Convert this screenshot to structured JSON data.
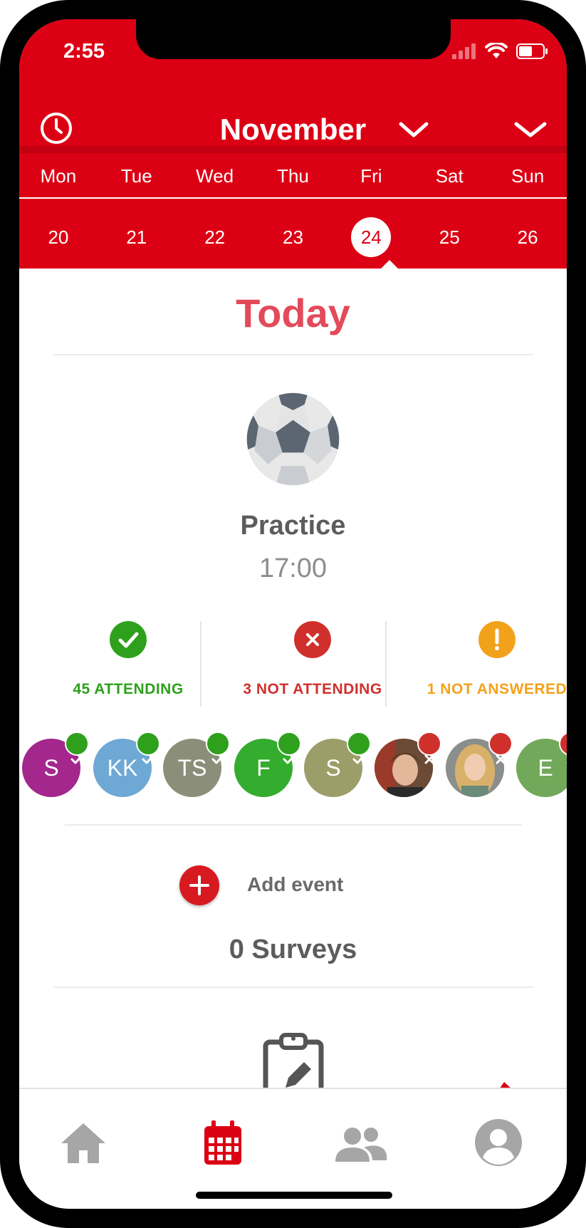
{
  "status_bar": {
    "time": "2:55"
  },
  "header": {
    "month": "November",
    "weekdays": [
      "Mon",
      "Tue",
      "Wed",
      "Thu",
      "Fri",
      "Sat",
      "Sun"
    ],
    "dates": [
      "20",
      "21",
      "22",
      "23",
      "24",
      "25",
      "26"
    ],
    "selected_date": "24",
    "accent_color": "#dc0014"
  },
  "today_label": "Today",
  "event": {
    "icon": "soccer-ball-icon",
    "title": "Practice",
    "time": "17:00"
  },
  "responses": {
    "attending": {
      "label": "45 ATTENDING",
      "color": "#2ea01c",
      "icon": "check-icon"
    },
    "not_attending": {
      "label": "3 NOT ATTENDING",
      "color": "#d0302c",
      "icon": "x-icon"
    },
    "not_answered": {
      "label": "1 NOT ANSWERED",
      "color": "#f2a21a",
      "icon": "exclamation-icon"
    }
  },
  "avatars": [
    {
      "initials": "S",
      "color": "#a3278c",
      "status": "attending"
    },
    {
      "initials": "KK",
      "color": "#6ea8d4",
      "status": "attending"
    },
    {
      "initials": "TS",
      "color": "#8b8f7a",
      "status": "attending"
    },
    {
      "initials": "F",
      "color": "#34ac2e",
      "status": "attending"
    },
    {
      "initials": "S",
      "color": "#9b9e68",
      "status": "attending"
    },
    {
      "initials": "",
      "color": "#7a5a42",
      "status": "not_attending",
      "photo": true
    },
    {
      "initials": "",
      "color": "#c9a67a",
      "status": "not_attending",
      "photo": true
    },
    {
      "initials": "E",
      "color": "#72a85a",
      "status": "not_attending"
    }
  ],
  "add_event": {
    "label": "Add event"
  },
  "surveys": {
    "label": "0 Surveys"
  },
  "tabs": [
    {
      "name": "home",
      "icon": "home-icon",
      "active": false
    },
    {
      "name": "calendar",
      "icon": "calendar-icon",
      "active": true
    },
    {
      "name": "team",
      "icon": "people-icon",
      "active": false
    },
    {
      "name": "profile",
      "icon": "profile-icon",
      "active": false
    }
  ]
}
